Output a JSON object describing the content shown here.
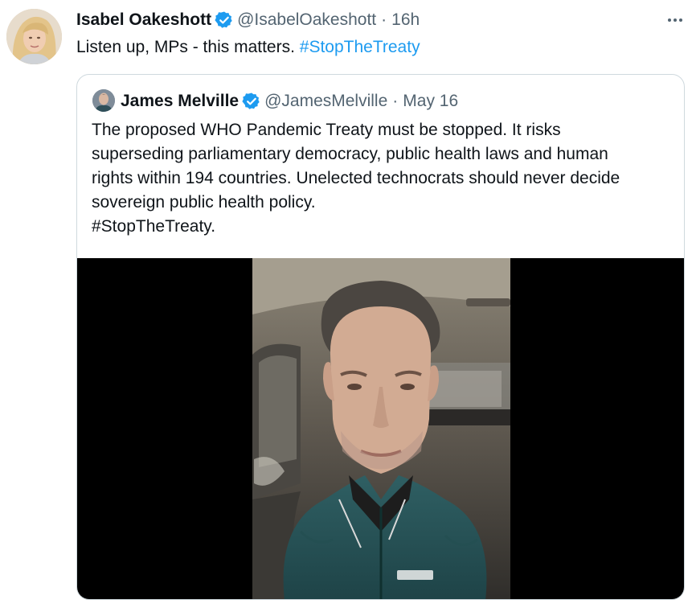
{
  "tweet": {
    "author_name": "Isabel Oakeshott",
    "author_handle": "@IsabelOakeshott",
    "separator": "·",
    "time": "16h",
    "text_prefix": "Listen up, MPs - this matters. ",
    "hashtag": "#StopTheTreaty",
    "icons": {
      "verified": "verified-badge-icon",
      "more": "more-options-icon"
    },
    "colors": {
      "link": "#1d9bf0",
      "secondary_text": "#536471",
      "border": "#cfd9de"
    }
  },
  "quoted_tweet": {
    "author_name": "James Melville",
    "author_handle": "@JamesMelville",
    "separator": "·",
    "date": "May 16",
    "text_lines": [
      "The proposed WHO Pandemic Treaty must be stopped. It risks",
      "superseding parliamentary democracy, public health laws and human",
      "rights within 194 countries. Unelected technocrats should never decide",
      "sovereign public health policy.",
      "#StopTheTreaty."
    ],
    "media": {
      "type": "video"
    }
  }
}
